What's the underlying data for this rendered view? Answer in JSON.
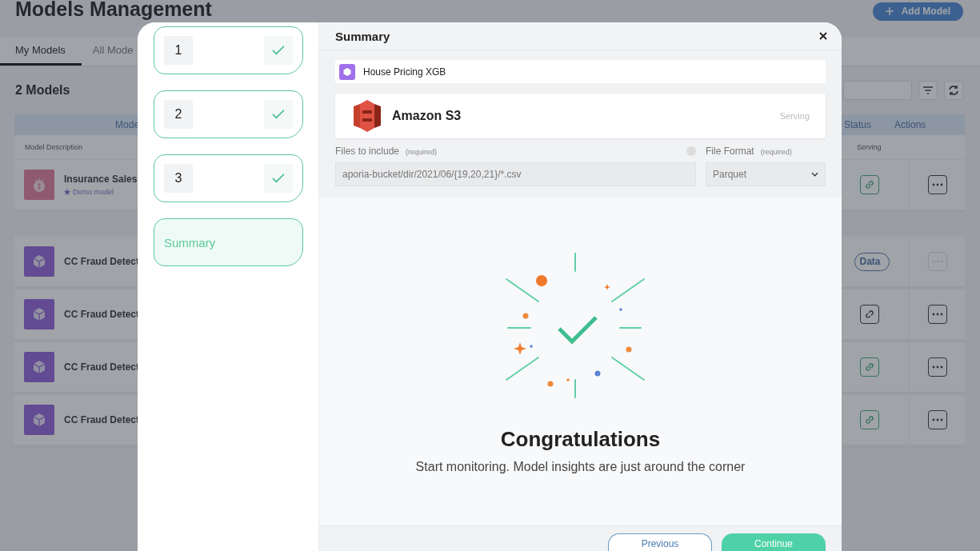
{
  "page": {
    "title": "Models Management",
    "add_button": "Add Model",
    "tabs": [
      {
        "label": "My Models",
        "selected": true
      },
      {
        "label": "All Mode",
        "selected": false
      }
    ],
    "count": "2 Models",
    "table": {
      "group_header": "Mode",
      "status_header": "Status",
      "actions_header": "Actions",
      "description_header": "Model Description",
      "serving_header": "Serving",
      "groups": [
        {
          "rows": [
            {
              "name": "Insurance Sales",
              "tag": "Demo model",
              "kind": "insurance",
              "serving": {
                "kind": "linked"
              },
              "actions_disabled": false
            }
          ]
        },
        {
          "rows": [
            {
              "name": "CC Fraud Detect",
              "kind": "cube",
              "serving": {
                "kind": "data",
                "label": "Data"
              },
              "actions_disabled": true
            },
            {
              "name": "CC Fraud Detect",
              "kind": "cube",
              "serving": {
                "kind": "unlinked"
              },
              "actions_disabled": false
            },
            {
              "name": "CC Fraud Detect",
              "kind": "cube",
              "serving": {
                "kind": "linked"
              },
              "actions_disabled": false
            },
            {
              "name": "CC Fraud Detect",
              "kind": "cube",
              "serving": {
                "kind": "linked"
              },
              "actions_disabled": false
            }
          ]
        }
      ]
    }
  },
  "modal": {
    "steps": [
      {
        "kind": "numbered",
        "label": "1",
        "checked": true,
        "selected": false
      },
      {
        "kind": "numbered",
        "label": "2",
        "checked": true,
        "selected": false
      },
      {
        "kind": "numbered",
        "label": "3",
        "checked": true,
        "selected": false
      },
      {
        "kind": "final",
        "label": "Summary",
        "selected": true
      }
    ],
    "title": "Summary",
    "model": "House Pricing XGB",
    "source": "Amazon S3",
    "source_status": "Serving",
    "files_label": "Files to include",
    "files_required": "(required)",
    "files_value": "aporia-bucket/dir/2021/06/{19,20,21}/*.csv",
    "format_label": "File Format",
    "format_required": "(required)",
    "format_value": "Parquet",
    "congrats_title": "Congratulations",
    "congrats_text": "Start monitoring. Model insights are just around the corner",
    "buttons": [
      {
        "kind": "secondary",
        "label": "Previous"
      },
      {
        "kind": "primary",
        "label": "Continue"
      }
    ]
  }
}
